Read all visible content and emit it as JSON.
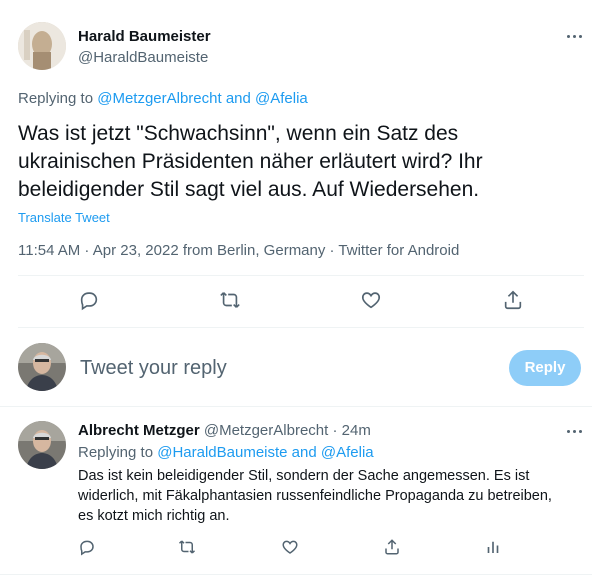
{
  "main_tweet": {
    "author_name": "Harald Baumeister",
    "author_handle": "@HaraldBaumeiste",
    "replying_prefix": "Replying to",
    "replying_users": "@MetzgerAlbrecht and @Afelia",
    "text": "Was ist jetzt \"Schwachsinn\", wenn ein Satz des ukrainischen Präsidenten näher erläutert wird? Ihr beleidigender Stil sagt viel aus. Auf Wiedersehen.",
    "translate_label": "Translate Tweet",
    "meta": "11:54 AM · Apr 23, 2022 from Berlin, Germany · Twitter for Android"
  },
  "composer": {
    "placeholder": "Tweet your reply",
    "reply_button": "Reply"
  },
  "reply_tweet": {
    "author_name": "Albrecht Metzger",
    "author_handle": "@MetzgerAlbrecht",
    "time": "· 24m",
    "replying_prefix": "Replying to",
    "replying_users": "@HaraldBaumeiste and @Afelia",
    "text": "Das ist kein beleidigender Stil, sondern der Sache angemessen. Es ist widerlich, mit Fäkalphantasien russenfeindliche Propaganda zu betreiben, es kotzt mich richtig an."
  },
  "colors": {
    "accent": "#1d9bf0",
    "reply_button_disabled": "#8ecdf8",
    "muted_text": "#536471",
    "divider": "#eff3f4"
  },
  "icons": [
    "more-icon",
    "reply-icon",
    "retweet-icon",
    "like-icon",
    "share-icon",
    "analytics-icon"
  ]
}
